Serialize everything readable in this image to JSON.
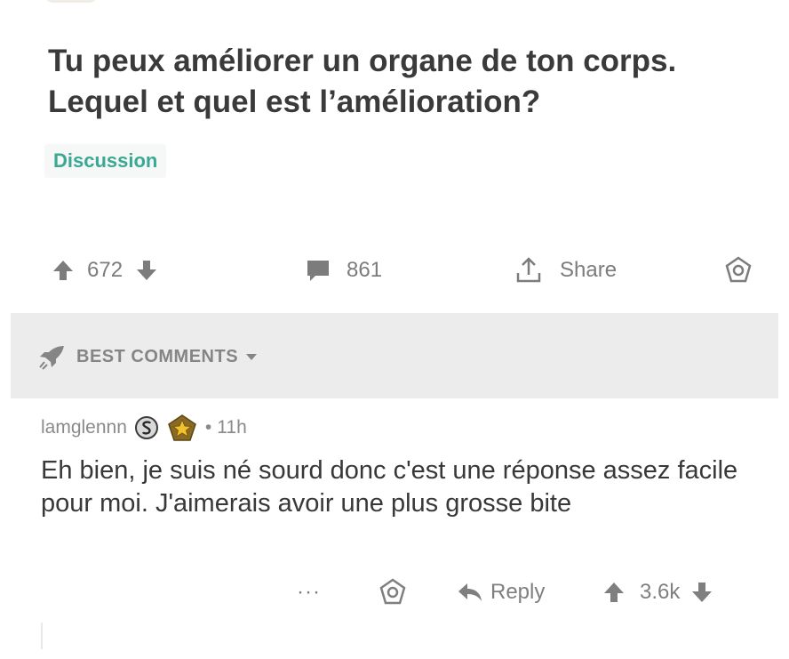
{
  "post": {
    "title": "Tu peux améliorer un organe de ton corps. Lequel et quel est l’amélioration?",
    "flair": "Discussion",
    "votes": "672",
    "comments_count": "861",
    "share_label": "Share"
  },
  "comments_section": {
    "sort_label": "BEST COMMENTS"
  },
  "comment": {
    "author": "lamglennn",
    "separator": "•",
    "time": "11h",
    "body": "Eh bien, je suis né sourd donc c'est une réponse assez facile pour moi. J'aimerais avoir une plus grosse bite",
    "more_label": "···",
    "reply_label": "Reply",
    "votes": "3.6k"
  },
  "colors": {
    "flair_text": "#3aa892",
    "icon_gray": "#7c7c7c",
    "section_bg": "#ececec"
  },
  "icons": [
    "upvote-icon",
    "downvote-icon",
    "comment-icon",
    "share-icon",
    "award-icon",
    "rocket-icon",
    "caret-down-icon",
    "silver-badge-icon",
    "star-award-icon",
    "reply-icon"
  ]
}
